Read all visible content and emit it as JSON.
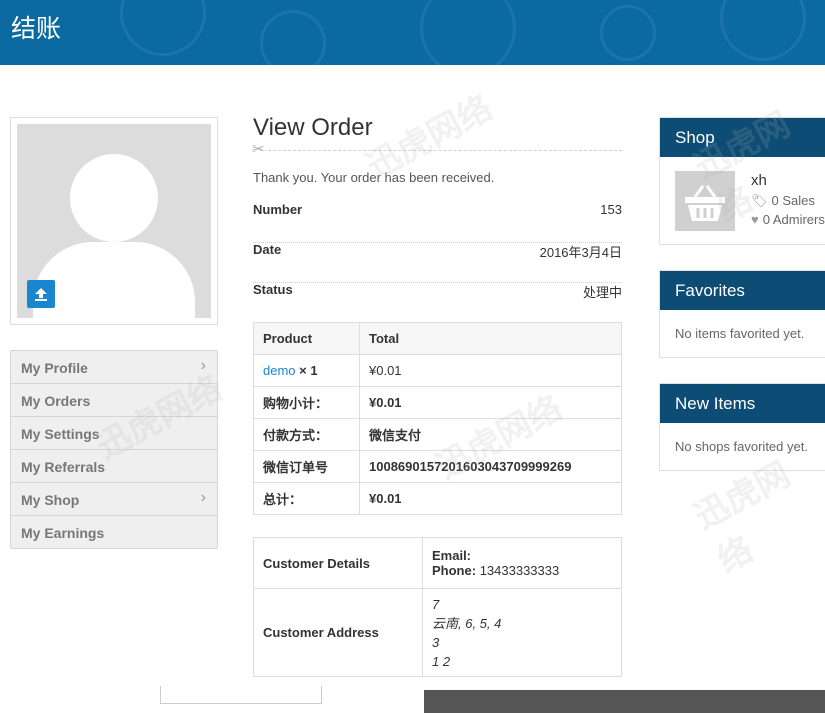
{
  "header": {
    "title": "结账"
  },
  "sidebar": {
    "items": [
      {
        "label": "My Profile",
        "chevron": true
      },
      {
        "label": "My Orders",
        "chevron": false
      },
      {
        "label": "My Settings",
        "chevron": false
      },
      {
        "label": "My Referrals",
        "chevron": false
      },
      {
        "label": "My Shop",
        "chevron": true
      },
      {
        "label": "My Earnings",
        "chevron": false
      }
    ]
  },
  "order": {
    "title": "View Order",
    "thanks": "Thank you. Your order has been received.",
    "number_label": "Number",
    "number": "153",
    "date_label": "Date",
    "date": "2016年3月4日",
    "status_label": "Status",
    "status": "处理中",
    "table": {
      "headers": [
        "Product",
        "Total"
      ],
      "product_name": "demo",
      "product_qty": "× 1",
      "product_total": "¥0.01",
      "rows": [
        {
          "label": "购物小计：",
          "value": "¥0.01"
        },
        {
          "label": "付款方式：",
          "value": "微信支付"
        },
        {
          "label": "微信订单号",
          "value": "1008690157201603043709999269"
        },
        {
          "label": "总计：",
          "value": "¥0.01"
        }
      ]
    }
  },
  "customer": {
    "details_label": "Customer Details",
    "email_label": "Email:",
    "phone_label": "Phone:",
    "phone": "13433333333",
    "address_label": "Customer Address",
    "address_lines": [
      "7",
      "云南, 6, 5, 4",
      "3",
      "1 2"
    ]
  },
  "shop_panel": {
    "title": "Shop",
    "name": "xh",
    "sales": "0 Sales",
    "admirers": "0 Admirers"
  },
  "favorites_panel": {
    "title": "Favorites",
    "empty": "No items favorited yet."
  },
  "new_items_panel": {
    "title": "New Items",
    "empty": "No shops favorited yet."
  },
  "colors": {
    "header": "#0b6aa2",
    "panel_header": "#0d4c74",
    "accent": "#1a86d0"
  }
}
